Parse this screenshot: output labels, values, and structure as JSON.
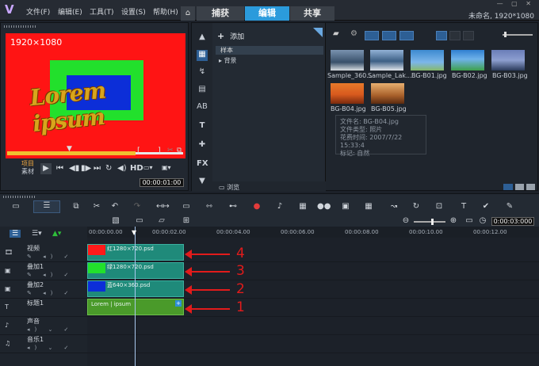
{
  "app": {
    "logo_glyph": "V",
    "menus": [
      "文件(F)",
      "编辑(E)",
      "工具(T)",
      "设置(S)",
      "帮助(H)"
    ],
    "tabs": [
      "捕获",
      "编辑",
      "共享"
    ],
    "home_glyph": "⌂",
    "project_info": "未命名, 1920*1080",
    "window_controls": "— ▢ ✕"
  },
  "player": {
    "resolution_label": "1920×1080",
    "overlay_text": "Lorem ipsum",
    "mode_project": "项目",
    "mode_clip": "素材",
    "hd_label": "HD",
    "timecode": "00:00:01:00",
    "bracket_in": "[",
    "bracket_out": "]"
  },
  "library": {
    "add_label": "添加",
    "tree": [
      "样本",
      "背景"
    ],
    "browse_label": "浏览",
    "thumbnails": [
      {
        "name": "Sample_360...",
        "color": "#506a88"
      },
      {
        "name": "Sample_Lak...",
        "color": "#5a7fa8"
      },
      {
        "name": "BG-B01.jpg",
        "color": "#3d8ad0"
      },
      {
        "name": "BG-B02.jpg",
        "color": "#3ea04a"
      },
      {
        "name": "BG-B03.jpg",
        "color": "#6a7db8"
      },
      {
        "name": "BG-B04.jpg",
        "color": "#d85a1e"
      },
      {
        "name": "BG-B05.jpg",
        "color": "#a8602a"
      }
    ],
    "tooltip": {
      "filename": "文件名: BG-B04.jpg",
      "filetype": "文件类型: 照片",
      "shot_time": "花费时间: 2007/7/22 15:33:4",
      "tags": "标记: 自然"
    }
  },
  "timeline": {
    "timecode": "0:00:03:000",
    "ruler": [
      "00:00:00.00",
      "00:00:02.00",
      "00:00:04.00",
      "00:00:06.00",
      "00:00:08.00",
      "00:00:10.00",
      "00:00:12.00"
    ],
    "tracks": [
      {
        "name": "视频",
        "icon": "🎞"
      },
      {
        "name": "叠加1",
        "icon": "▣"
      },
      {
        "name": "叠加2",
        "icon": "▣"
      },
      {
        "name": "标题1",
        "icon": "T"
      },
      {
        "name": "声音",
        "icon": "♪"
      },
      {
        "name": "音乐1",
        "icon": "♫"
      }
    ],
    "clips": [
      {
        "label": "红1280×720.psd",
        "thumb_color": "#ff1a1a"
      },
      {
        "label": "绿1280×720.psd",
        "thumb_color": "#22e02c"
      },
      {
        "label": "蓝640×360.psd",
        "thumb_color": "#0c2ed8"
      },
      {
        "label": "Lorem | ipsum",
        "thumb_color": "#4a9a2a"
      }
    ],
    "annotations": [
      "4",
      "3",
      "2",
      "1"
    ]
  }
}
